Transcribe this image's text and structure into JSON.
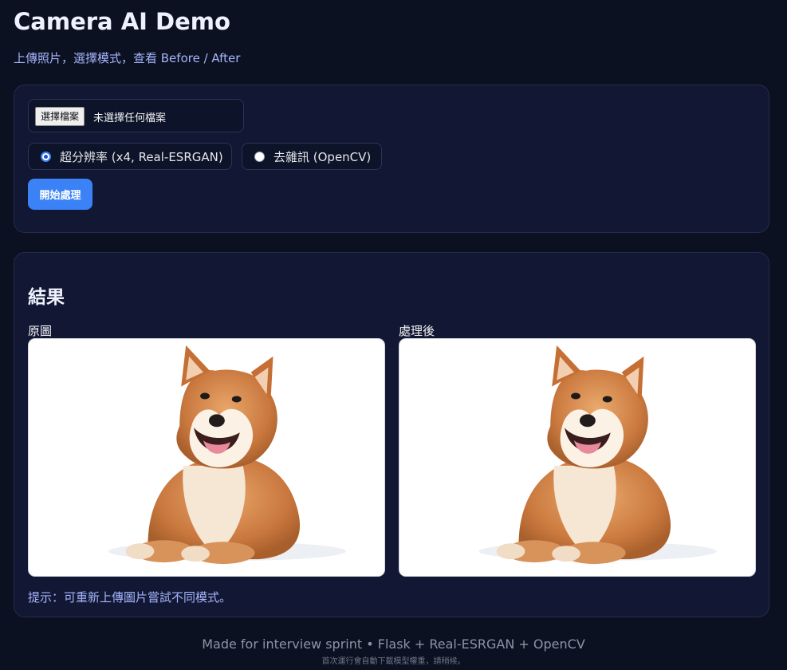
{
  "header": {
    "title": "Camera AI Demo",
    "subtitle": "上傳照片，選擇模式，查看 Before / After"
  },
  "form": {
    "file_button_label": "選擇檔案",
    "file_status": "未選擇任何檔案",
    "modes": [
      {
        "label": "超分辨率 (x4, Real-ESRGAN)",
        "selected": true
      },
      {
        "label": "去雜訊 (OpenCV)",
        "selected": false
      }
    ],
    "submit_label": "開始處理"
  },
  "result": {
    "heading": "結果",
    "before_label": "原圖",
    "after_label": "處理後",
    "tip": "提示：可重新上傳圖片嘗試不同模式。"
  },
  "footer": {
    "main": "Made for interview sprint • Flask + Real-ESRGAN + OpenCV",
    "note": "首次運行會自動下載模型權重，請稍候。"
  },
  "colors": {
    "background": "#0b1120",
    "card": "#121833",
    "accent": "#3b82f6",
    "subtitle": "#a5b4fc"
  }
}
